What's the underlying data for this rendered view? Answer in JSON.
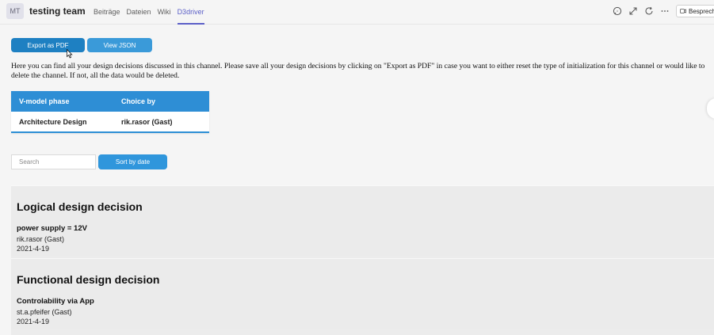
{
  "header": {
    "avatar_initials": "MT",
    "team_name": "testing team",
    "tabs": [
      {
        "label": "Beiträge",
        "active": false
      },
      {
        "label": "Dateien",
        "active": false
      },
      {
        "label": "Wiki",
        "active": false
      },
      {
        "label": "D3driver",
        "active": true
      }
    ],
    "icons": [
      "chat-icon",
      "expand-icon",
      "refresh-icon",
      "more-icon"
    ],
    "meet_label": "Besprech"
  },
  "toolbar": {
    "export_label": "Export as PDF",
    "json_label": "View JSON"
  },
  "intro_text": "Here you can find all your design decisions discussed in this channel. Please save all your design decisions by clicking on \"Export as PDF\" in case you want to either reset the type of initialization for this channel or would like to delete the channel. If not, all the data would be deleted.",
  "phase_table": {
    "headers": [
      "V-model phase",
      "Choice by"
    ],
    "row": [
      "Architecture Design",
      "rik.rasor (Gast)"
    ]
  },
  "filter": {
    "search_placeholder": "Search",
    "sort_label": "Sort by date"
  },
  "decisions": [
    {
      "title": "Logical design decision",
      "subtitle": "power supply = 12V",
      "author": "rik.rasor (Gast)",
      "date": "2021-4-19"
    },
    {
      "title": "Functional design decision",
      "subtitle": "Controlability via App",
      "author": "st.a.pfeifer (Gast)",
      "date": "2021-4-19"
    }
  ],
  "colors": {
    "accent": "#5b5fc7",
    "primary_button": "#1e80c2",
    "table_header": "#2e8ed5"
  }
}
